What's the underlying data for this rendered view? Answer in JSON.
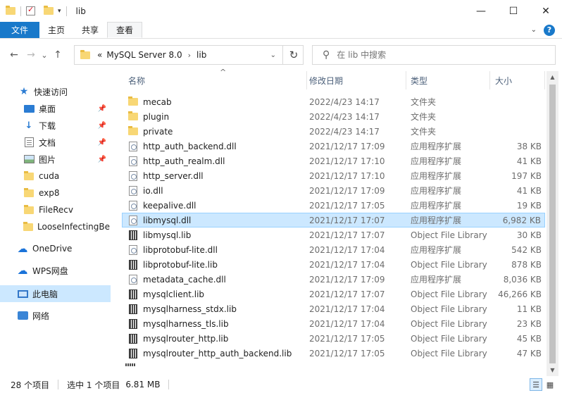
{
  "window": {
    "title": "lib",
    "controls": {
      "minimize": "—",
      "maximize": "☐",
      "close": "✕"
    }
  },
  "ribbon": {
    "tabs": [
      "文件",
      "主页",
      "共享",
      "查看"
    ],
    "active": "查看",
    "help": "?"
  },
  "nav": {
    "back": "←",
    "forward": "→",
    "recent": "⌄",
    "up": "↑",
    "breadcrumb_overflow": "«",
    "path": [
      "MySQL Server 8.0",
      "lib"
    ],
    "refresh": "↻",
    "search_placeholder": "在 lib 中搜索"
  },
  "sidebar": {
    "items": [
      {
        "label": "快速访问",
        "icon": "star-icon"
      },
      {
        "label": "桌面",
        "icon": "desktop-icon",
        "pinned": true
      },
      {
        "label": "下载",
        "icon": "download-icon",
        "pinned": true
      },
      {
        "label": "文档",
        "icon": "document-icon",
        "pinned": true
      },
      {
        "label": "图片",
        "icon": "picture-icon",
        "pinned": true
      },
      {
        "label": "cuda",
        "icon": "folder-icon"
      },
      {
        "label": "exp8",
        "icon": "folder-icon"
      },
      {
        "label": "FileRecv",
        "icon": "folder-icon"
      },
      {
        "label": "LooseInfectingBel",
        "icon": "folder-icon"
      },
      {
        "label": "OneDrive",
        "icon": "cloud-icon"
      },
      {
        "label": "WPS网盘",
        "icon": "wps-cloud-icon"
      },
      {
        "label": "此电脑",
        "icon": "computer-icon",
        "selected": true
      },
      {
        "label": "网络",
        "icon": "network-icon"
      }
    ]
  },
  "columns": {
    "name": "名称",
    "date": "修改日期",
    "type": "类型",
    "size": "大小"
  },
  "files": [
    {
      "name": "mecab",
      "date": "2022/4/23 14:17",
      "type": "文件夹",
      "size": "",
      "icon": "folder-icon"
    },
    {
      "name": "plugin",
      "date": "2022/4/23 14:17",
      "type": "文件夹",
      "size": "",
      "icon": "folder-icon"
    },
    {
      "name": "private",
      "date": "2022/4/23 14:17",
      "type": "文件夹",
      "size": "",
      "icon": "folder-icon"
    },
    {
      "name": "http_auth_backend.dll",
      "date": "2021/12/17 17:09",
      "type": "应用程序扩展",
      "size": "38 KB",
      "icon": "dll-icon"
    },
    {
      "name": "http_auth_realm.dll",
      "date": "2021/12/17 17:10",
      "type": "应用程序扩展",
      "size": "41 KB",
      "icon": "dll-icon"
    },
    {
      "name": "http_server.dll",
      "date": "2021/12/17 17:10",
      "type": "应用程序扩展",
      "size": "197 KB",
      "icon": "dll-icon"
    },
    {
      "name": "io.dll",
      "date": "2021/12/17 17:09",
      "type": "应用程序扩展",
      "size": "41 KB",
      "icon": "dll-icon"
    },
    {
      "name": "keepalive.dll",
      "date": "2021/12/17 17:05",
      "type": "应用程序扩展",
      "size": "19 KB",
      "icon": "dll-icon"
    },
    {
      "name": "libmysql.dll",
      "date": "2021/12/17 17:07",
      "type": "应用程序扩展",
      "size": "6,982 KB",
      "icon": "dll-icon",
      "selected": true
    },
    {
      "name": "libmysql.lib",
      "date": "2021/12/17 17:07",
      "type": "Object File Library",
      "size": "30 KB",
      "icon": "lib-icon"
    },
    {
      "name": "libprotobuf-lite.dll",
      "date": "2021/12/17 17:04",
      "type": "应用程序扩展",
      "size": "542 KB",
      "icon": "dll-icon"
    },
    {
      "name": "libprotobuf-lite.lib",
      "date": "2021/12/17 17:04",
      "type": "Object File Library",
      "size": "878 KB",
      "icon": "lib-icon"
    },
    {
      "name": "metadata_cache.dll",
      "date": "2021/12/17 17:09",
      "type": "应用程序扩展",
      "size": "8,036 KB",
      "icon": "dll-icon"
    },
    {
      "name": "mysqlclient.lib",
      "date": "2021/12/17 17:07",
      "type": "Object File Library",
      "size": "46,266 KB",
      "icon": "lib-icon"
    },
    {
      "name": "mysqlharness_stdx.lib",
      "date": "2021/12/17 17:04",
      "type": "Object File Library",
      "size": "11 KB",
      "icon": "lib-icon"
    },
    {
      "name": "mysqlharness_tls.lib",
      "date": "2021/12/17 17:04",
      "type": "Object File Library",
      "size": "23 KB",
      "icon": "lib-icon"
    },
    {
      "name": "mysqlrouter_http.lib",
      "date": "2021/12/17 17:05",
      "type": "Object File Library",
      "size": "45 KB",
      "icon": "lib-icon"
    },
    {
      "name": "mysqlrouter_http_auth_backend.lib",
      "date": "2021/12/17 17:05",
      "type": "Object File Library",
      "size": "47 KB",
      "icon": "lib-icon"
    }
  ],
  "status": {
    "item_count": "28 个项目",
    "selection": "选中 1 个项目",
    "selection_size": "6.81 MB"
  }
}
